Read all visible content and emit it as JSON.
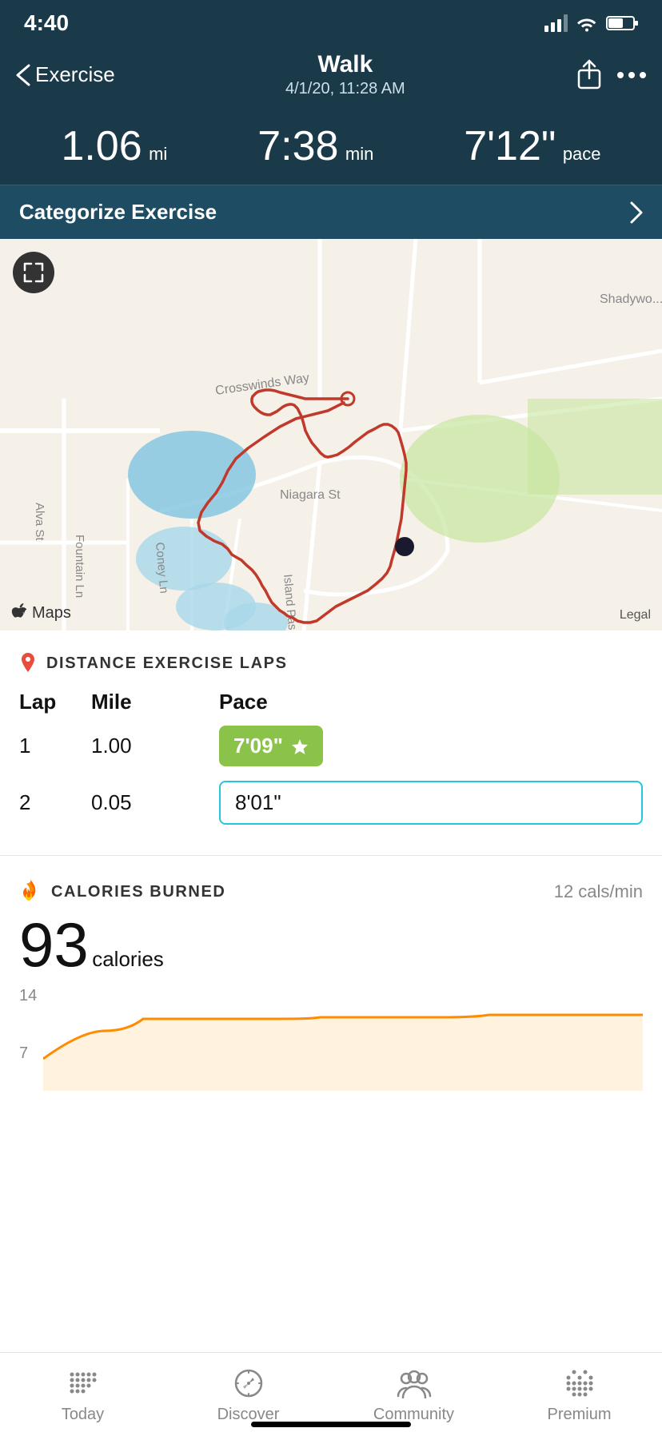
{
  "statusBar": {
    "time": "4:40"
  },
  "navHeader": {
    "backLabel": "Exercise",
    "title": "Walk",
    "subtitle": "4/1/20, 11:28 AM"
  },
  "stats": {
    "distance": "1.06",
    "distanceUnit": "mi",
    "duration": "7:38",
    "durationUnit": "min",
    "pace": "7'12\"",
    "paceUnit": "pace"
  },
  "categorize": {
    "label": "Categorize Exercise"
  },
  "laps": {
    "sectionIcon": "📍",
    "sectionTitle": "DISTANCE EXERCISE LAPS",
    "headers": [
      "Lap",
      "Mile",
      "Pace"
    ],
    "rows": [
      {
        "lap": "1",
        "mile": "1.00",
        "pace": "7'09\"",
        "best": true
      },
      {
        "lap": "2",
        "mile": "0.05",
        "pace": "8'01\"",
        "best": false
      }
    ]
  },
  "calories": {
    "sectionTitle": "CALORIES BURNED",
    "rate": "12 cals/min",
    "value": "93",
    "unit": "calories",
    "chartLabels": {
      "top": "14",
      "mid": "7"
    }
  },
  "bottomNav": {
    "items": [
      {
        "id": "today",
        "label": "Today"
      },
      {
        "id": "discover",
        "label": "Discover"
      },
      {
        "id": "community",
        "label": "Community"
      },
      {
        "id": "premium",
        "label": "Premium"
      }
    ]
  }
}
